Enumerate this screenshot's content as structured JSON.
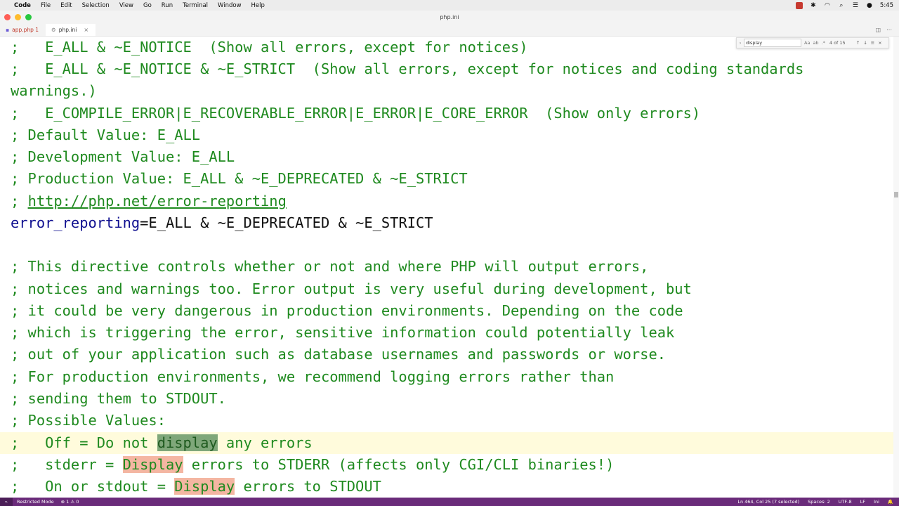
{
  "menubar": {
    "app": "Code",
    "items": [
      "File",
      "Edit",
      "Selection",
      "View",
      "Go",
      "Run",
      "Terminal",
      "Window",
      "Help"
    ],
    "clock": "5:45"
  },
  "window": {
    "title": "php.ini"
  },
  "tabs": [
    {
      "label": "app.php 1",
      "active": false
    },
    {
      "label": "php.ini",
      "active": true
    }
  ],
  "find": {
    "query": "display",
    "count": "4 of 15",
    "options": [
      "Aa",
      "ab",
      ".*"
    ]
  },
  "editor": {
    "lines": [
      {
        "text": ";   E_ALL & ~E_NOTICE  (Show all errors, except for notices)"
      },
      {
        "text": ";   E_ALL & ~E_NOTICE & ~E_STRICT  (Show all errors, except for notices and coding standards"
      },
      {
        "text": "warnings.)"
      },
      {
        "text": ";   E_COMPILE_ERROR|E_RECOVERABLE_ERROR|E_ERROR|E_CORE_ERROR  (Show only errors)"
      },
      {
        "text": "; Default Value: E_ALL"
      },
      {
        "text": "; Development Value: E_ALL"
      },
      {
        "text": "; Production Value: E_ALL & ~E_DEPRECATED & ~E_STRICT"
      },
      {
        "prefix": "; ",
        "link": "http://php.net/error-reporting"
      },
      {
        "key": "error_reporting",
        "value": "=E_ALL & ~E_DEPRECATED & ~E_STRICT"
      },
      {
        "text": ""
      },
      {
        "text": "; This directive controls whether or not and where PHP will output errors,"
      },
      {
        "text": "; notices and warnings too. Error output is very useful during development, but"
      },
      {
        "text": "; it could be very dangerous in production environments. Depending on the code"
      },
      {
        "text": "; which is triggering the error, sensitive information could potentially leak"
      },
      {
        "text": "; out of your application such as database usernames and passwords or worse."
      },
      {
        "text": "; For production environments, we recommend logging errors rather than"
      },
      {
        "text": "; sending them to STDOUT."
      },
      {
        "text": "; Possible Values:"
      },
      {
        "before": ";   Off = Do not ",
        "match": "display",
        "after": " any errors",
        "current": true
      },
      {
        "before": ";   stderr = ",
        "match": "Display",
        "after": " errors to STDERR (affects only CGI/CLI binaries!)"
      },
      {
        "before": ";   On or stdout = ",
        "match": "Display",
        "after": " errors to STDOUT"
      }
    ]
  },
  "statusbar": {
    "remote": "Restricted Mode",
    "problems": "⊗ 1 ⚠ 0",
    "position": "Ln 464, Col 25 (7 selected)",
    "spaces": "Spaces: 2",
    "encoding": "UTF-8",
    "eol": "LF",
    "language": "Ini"
  }
}
